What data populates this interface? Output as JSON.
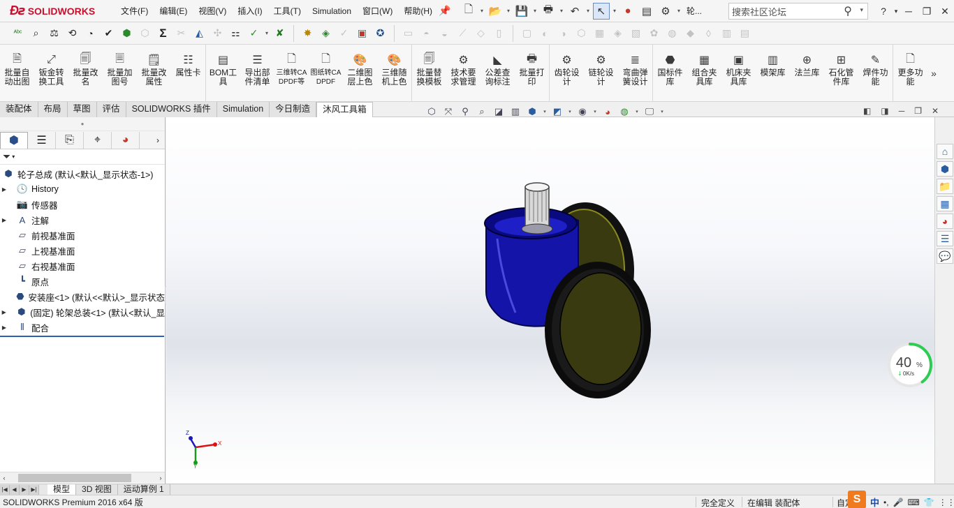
{
  "app": {
    "brand": "SOLIDWORKS",
    "status_title": "SOLIDWORKS Premium 2016 x64 版"
  },
  "menu": [
    "文件(F)",
    "编辑(E)",
    "视图(V)",
    "插入(I)",
    "工具(T)",
    "Simulation",
    "窗口(W)",
    "帮助(H)"
  ],
  "quick": {
    "doc_short": "轮..."
  },
  "search": {
    "placeholder": "搜索社区论坛"
  },
  "command_bar": {
    "group1": [
      {
        "label": "批量自动出图",
        "icon": "batch-drawing-icon"
      },
      {
        "label": "钣金转换工具",
        "icon": "sheetmetal-convert-icon"
      },
      {
        "label": "批量改名",
        "icon": "batch-rename-icon"
      },
      {
        "label": "批量加图号",
        "icon": "batch-number-icon"
      },
      {
        "label": "批量改属性",
        "icon": "batch-property-icon"
      },
      {
        "label": "属性卡",
        "icon": "property-card-icon"
      }
    ],
    "group2": [
      {
        "label": "BOM工具",
        "icon": "bom-tool-icon"
      },
      {
        "label": "导出部件清单",
        "icon": "export-parts-icon"
      },
      {
        "label": "三维转CADPDF等",
        "icon": "3d-to-cadpdf-icon"
      },
      {
        "label": "图纸转CADPDF",
        "icon": "drawing-to-cadpdf-icon"
      },
      {
        "label": "二维图层上色",
        "icon": "layer-color-icon"
      },
      {
        "label": "三维随机上色",
        "icon": "random-color-icon"
      }
    ],
    "group3": [
      {
        "label": "批量替换模板",
        "icon": "replace-template-icon"
      },
      {
        "label": "技术要求管理",
        "icon": "tech-req-icon"
      },
      {
        "label": "公差查询标注",
        "icon": "tolerance-icon"
      },
      {
        "label": "批量打印",
        "icon": "batch-print-icon"
      }
    ],
    "group4": [
      {
        "label": "齿轮设计",
        "icon": "gear-design-icon"
      },
      {
        "label": "链轮设计",
        "icon": "sprocket-design-icon"
      },
      {
        "label": "弯曲弹簧设计",
        "icon": "spring-design-icon"
      }
    ],
    "group5": [
      {
        "label": "国标件库",
        "icon": "standard-parts-icon"
      },
      {
        "label": "组合夹具库",
        "icon": "fixture-lib-icon"
      },
      {
        "label": "机床夹具库",
        "icon": "machine-fixture-icon"
      },
      {
        "label": "模架库",
        "icon": "mold-base-icon"
      },
      {
        "label": "法兰库",
        "icon": "flange-lib-icon"
      },
      {
        "label": "石化管件库",
        "icon": "pipe-fitting-icon"
      },
      {
        "label": "焊件功能",
        "icon": "weldment-icon"
      }
    ],
    "group6": [
      {
        "label": "更多功能",
        "icon": "more-features-icon"
      }
    ]
  },
  "tabs": [
    "装配体",
    "布局",
    "草图",
    "评估",
    "SOLIDWORKS 插件",
    "Simulation",
    "今日制造",
    "沐风工具箱"
  ],
  "active_tab": "沐风工具箱",
  "tree": {
    "root": "轮子总成 (默认<默认_显示状态-1>)",
    "items": [
      {
        "label": "History",
        "expandable": true,
        "icon": "history-icon"
      },
      {
        "label": "传感器",
        "expandable": false,
        "icon": "sensor-icon"
      },
      {
        "label": "注解",
        "expandable": true,
        "icon": "annotation-icon"
      },
      {
        "label": "前视基准面",
        "expandable": false,
        "icon": "plane-icon"
      },
      {
        "label": "上视基准面",
        "expandable": false,
        "icon": "plane-icon"
      },
      {
        "label": "右视基准面",
        "expandable": false,
        "icon": "plane-icon"
      },
      {
        "label": "原点",
        "expandable": false,
        "icon": "origin-icon"
      },
      {
        "label": "安装座<1> (默认<<默认>_显示状态",
        "expandable": false,
        "icon": "part-icon"
      },
      {
        "label": "(固定) 轮架总装<1> (默认<默认_显",
        "expandable": true,
        "icon": "assembly-icon"
      },
      {
        "label": "配合",
        "expandable": true,
        "icon": "mate-icon"
      }
    ]
  },
  "triad": {
    "x": "X",
    "y": "Y",
    "z": "Z"
  },
  "network": {
    "percent": "40",
    "percent_sign": "%",
    "speed": "0K/s",
    "progress": 0.4
  },
  "bottom_tabs": [
    "模型",
    "3D 视图",
    "运动算例 1"
  ],
  "active_bottom_tab": "模型",
  "status": {
    "defined": "完全定义",
    "editing": "在编辑 装配体",
    "custom": "自定"
  },
  "ime": {
    "logo": "S",
    "lang": "中"
  },
  "colors": {
    "brand_red": "#c8102e",
    "housing_blue": "#1414a8",
    "wheel_face": "#3a3a10",
    "network_green": "#2ecc52"
  }
}
